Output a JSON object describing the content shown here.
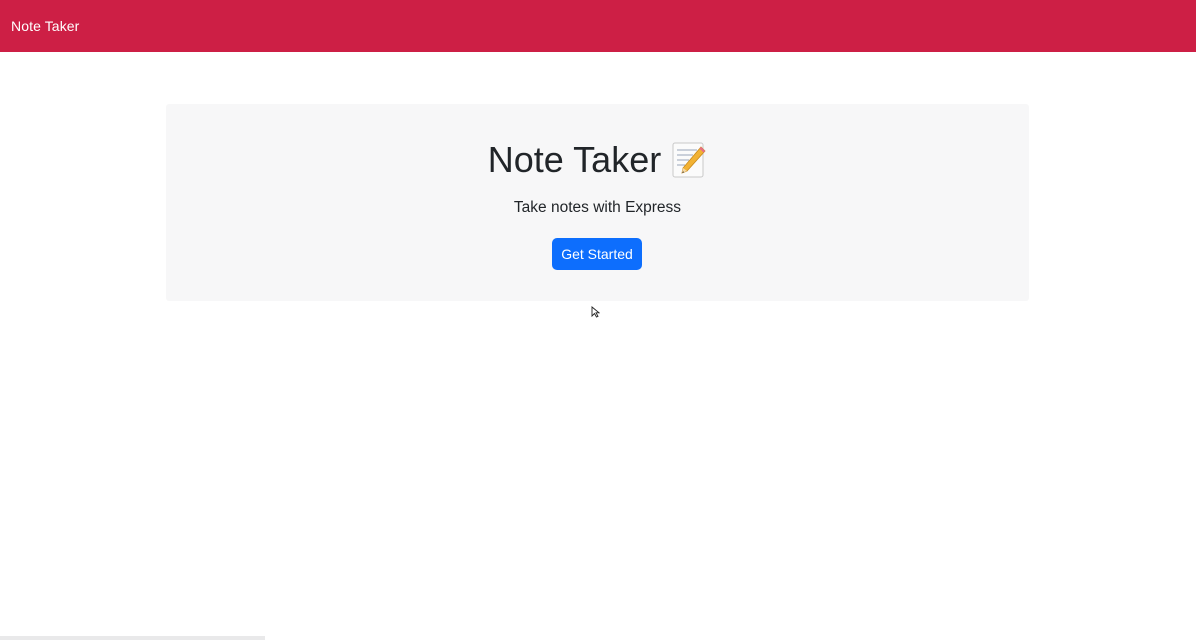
{
  "navbar": {
    "brand": "Note Taker",
    "color": "#cd1f45"
  },
  "hero": {
    "title": "Note Taker",
    "title_icon": "memo-pencil-icon",
    "subtitle": "Take notes with Express",
    "cta_label": "Get Started",
    "cta_color": "#0d6efd",
    "background": "#f7f7f8"
  }
}
